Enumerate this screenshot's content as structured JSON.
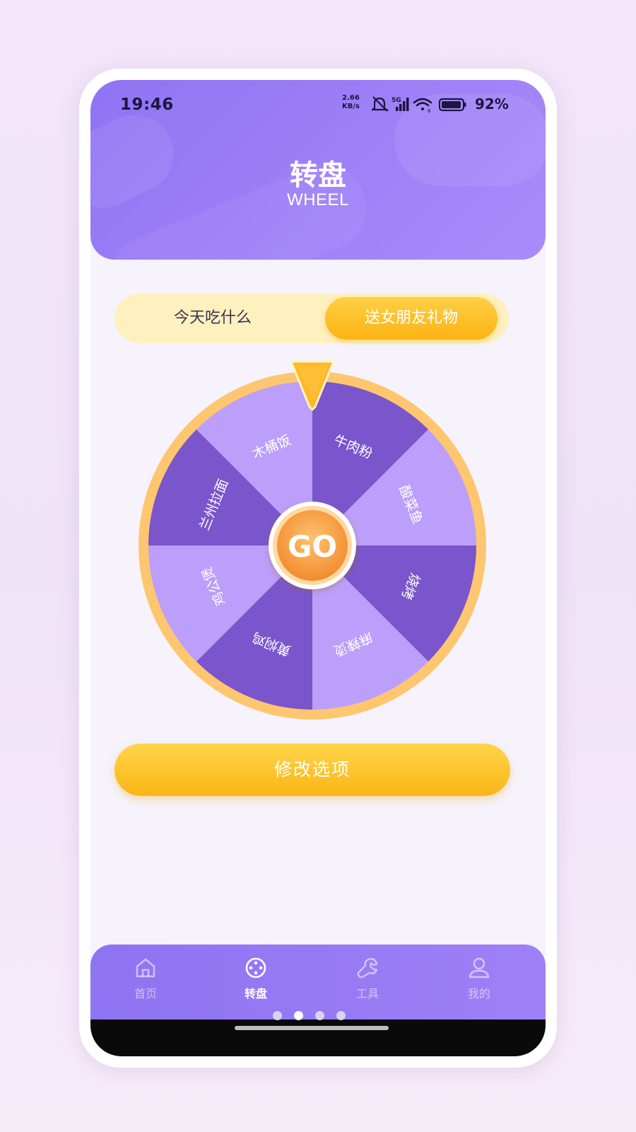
{
  "status_bar": {
    "time": "19:46",
    "net_speed_value": "2.66",
    "net_speed_unit": "KB/s",
    "signal_label": "5G",
    "battery": "92%",
    "icons": [
      "mute-icon",
      "signal-icon",
      "wifi-icon",
      "battery-icon"
    ]
  },
  "header": {
    "title": "转盘",
    "subtitle": "WHEEL"
  },
  "mode_tabs": [
    {
      "label": "今天吃什么",
      "active": false
    },
    {
      "label": "送女朋友礼物",
      "active": true
    }
  ],
  "wheel": {
    "center_label": "GO",
    "segments": [
      "牛肉粉",
      "酸菜鱼",
      "烧烤",
      "麻辣烫",
      "黄焖鸡",
      "鸡公煲",
      "兰州拉面",
      "木桶饭"
    ],
    "colors": {
      "dark": "#7a55cc",
      "light": "#bb9ffa",
      "rim": "#ffc670",
      "pointer": "#ffb829",
      "go_orange": "#f8a24c"
    }
  },
  "edit_button": {
    "label": "修改选项"
  },
  "bottom_nav": [
    {
      "label": "首页",
      "icon": "home-icon",
      "active": false
    },
    {
      "label": "转盘",
      "icon": "wheel-icon",
      "active": true
    },
    {
      "label": "工具",
      "icon": "wrench-icon",
      "active": false
    },
    {
      "label": "我的",
      "icon": "user-icon",
      "active": false
    }
  ],
  "page_indicator": {
    "count": 4,
    "active_index": 1
  },
  "theme": {
    "header_purple": "#9a7cf6",
    "yellow": "#fbbd22",
    "segment_bg": "#fff0bf"
  }
}
